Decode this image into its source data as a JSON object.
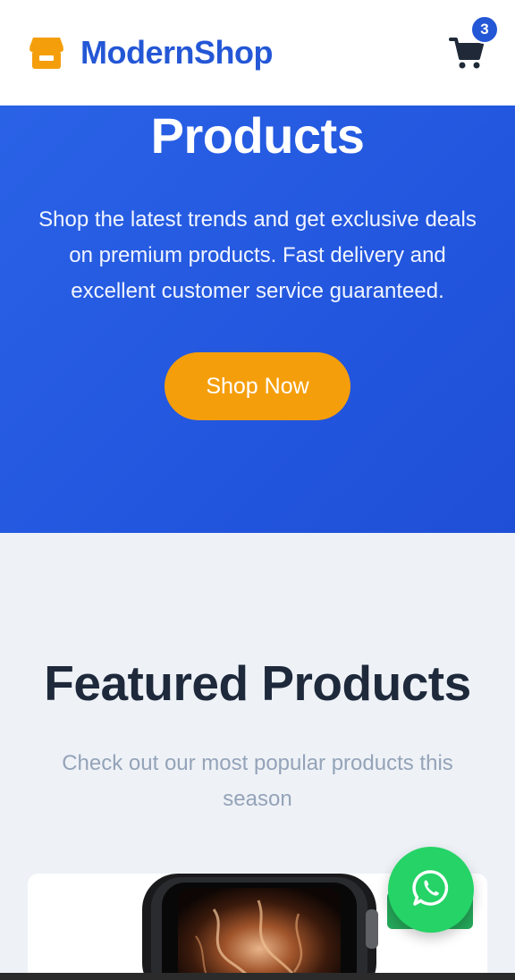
{
  "header": {
    "brand_name": "ModernShop",
    "brand_icon": "storefront-icon",
    "cart_icon": "shopping-cart-icon",
    "cart_count": "3"
  },
  "hero": {
    "title": "Products",
    "text": "Shop the latest trends and get exclusive deals on premium products. Fast delivery and excellent customer service guaranteed.",
    "button_label": "Shop Now"
  },
  "featured": {
    "title": "Featured Products",
    "subtitle": "Check out our most popular products this season"
  },
  "product": {
    "image_icon": "smartwatch-image"
  },
  "floating": {
    "whatsapp_icon": "whatsapp-icon"
  },
  "colors": {
    "brand": "#2457d6",
    "hero_bg": "#2256de",
    "accent": "#f59e0b",
    "whatsapp": "#25d366",
    "title_dark": "#1e293b",
    "subtitle_gray": "#94a3b8",
    "page_bg": "#eef2f7"
  }
}
